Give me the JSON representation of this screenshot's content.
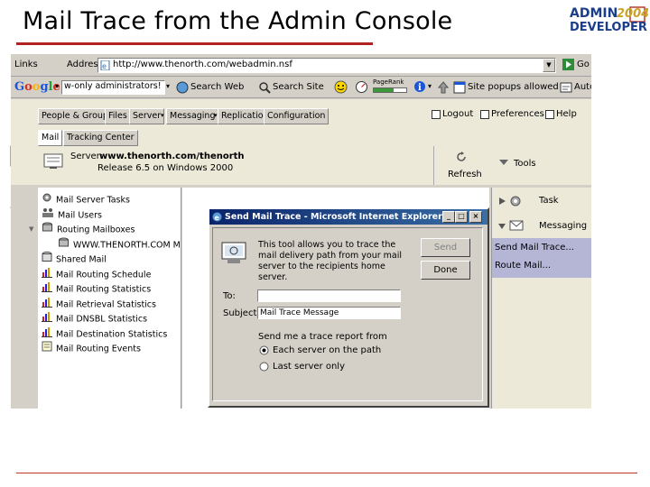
{
  "slide": {
    "title": "Mail Trace from the Admin Console",
    "logo_line1": "ADMIN",
    "logo_year": "2004",
    "logo_line2": "DEVELOPER"
  },
  "address_bar": {
    "links_label": "Links",
    "address_label": "Address",
    "url": "http://www.thenorth.com/webadmin.nsf",
    "go_label": "Go"
  },
  "google_bar": {
    "brand": "Google",
    "search_value": "w-only administrators!",
    "search_web": "Search Web",
    "search_site": "Search Site",
    "pagerank": "PageRank",
    "popups": "Site popups allowed",
    "autofill": "AutoFill"
  },
  "console": {
    "nav_tabs": [
      "People & Groups",
      "Files",
      "Server",
      "Messaging",
      "Replication",
      "Configuration"
    ],
    "top_links": [
      "Logout",
      "Preferences",
      "Help"
    ],
    "sub_tabs": [
      "Mail",
      "Tracking Center"
    ],
    "server_label": "Server:",
    "server_name": "www.thenorth.com/thenorth",
    "release": "Release 6.5 on Windows 2000",
    "refresh": "Refresh",
    "tools": "Tools",
    "tree": [
      {
        "label": "Mail Server Tasks",
        "icon": "tasks-icon"
      },
      {
        "label": "Mail Users",
        "icon": "users-icon"
      },
      {
        "label": "Routing Mailboxes",
        "icon": "mailbox-icon"
      },
      {
        "label": "WWW.THENORTH.COM M",
        "icon": "mailbox-icon"
      },
      {
        "label": "Shared Mail",
        "icon": "database-icon"
      },
      {
        "label": "Mail Routing Schedule",
        "icon": "chart-icon"
      },
      {
        "label": "Mail Routing Statistics",
        "icon": "chart-icon"
      },
      {
        "label": "Mail Retrieval Statistics",
        "icon": "chart-icon"
      },
      {
        "label": "Mail DNSBL Statistics",
        "icon": "chart-icon"
      },
      {
        "label": "Mail Destination Statistics",
        "icon": "chart-icon"
      },
      {
        "label": "Mail Routing Events",
        "icon": "document-icon"
      }
    ],
    "right_task": "Task",
    "right_messaging": "Messaging",
    "right_items": [
      "Send Mail Trace...",
      "Route Mail..."
    ]
  },
  "dialog": {
    "title": "Send Mail Trace - Microsoft Internet Explorer",
    "description": "This tool allows you to trace the mail delivery path from your mail server to the recipients home server.",
    "send_btn": "Send",
    "done_btn": "Done",
    "to_label": "To:",
    "to_value": "",
    "subject_label": "Subject:",
    "subject_value": "Mail Trace Message",
    "report_label": "Send me a trace report from",
    "options": [
      "Each server on the path",
      "Last server only"
    ],
    "selected_option": 0
  },
  "colors": {
    "title_rule": "#b22222",
    "dialog_title_bg": "#0a246a",
    "selected_panel": "#b5b5d6"
  }
}
